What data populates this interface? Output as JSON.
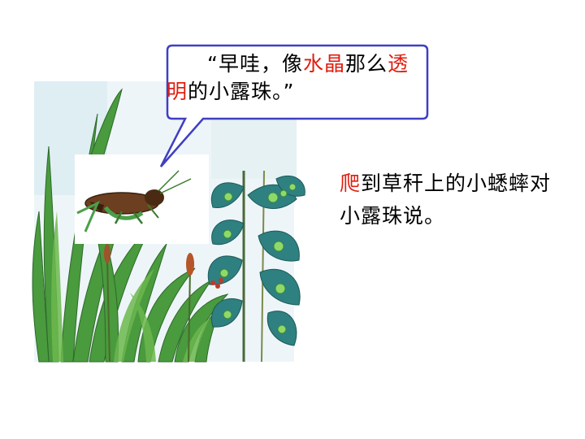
{
  "speech_bubble": {
    "open_quote": "“",
    "part1": "早哇，像",
    "highlight1": "水晶",
    "part2": "那么",
    "highlight2": "透明",
    "part3": "的小露珠。”"
  },
  "narration": {
    "highlight": "爬",
    "text": "到草秆上的小蟋蟀对小露珠说。"
  },
  "colors": {
    "highlight": "#e01e10",
    "bubble_border": "#3f3fc4",
    "grass": "#3d8f3a",
    "leaf": "#2f7e7a"
  },
  "illustration": {
    "subject": "cricket-on-grass-with-dewdrops"
  }
}
